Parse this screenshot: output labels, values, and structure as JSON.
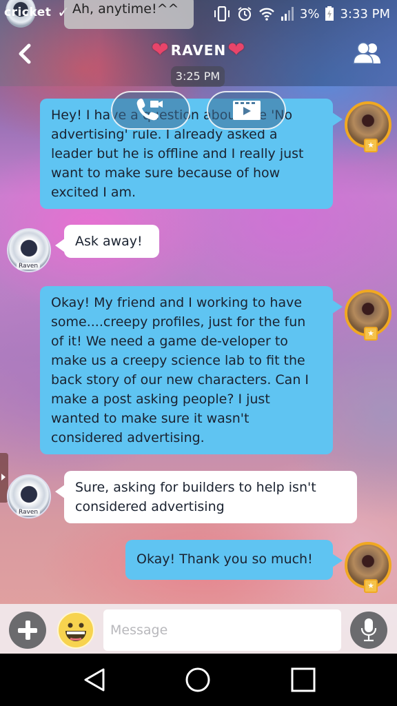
{
  "status_bar": {
    "carrier": "cricket",
    "notification_text": "Ah, anytime!^^",
    "battery": "3%",
    "time": "3:33 PM",
    "icons": [
      "vibrate-icon",
      "alarm-icon",
      "wifi-icon",
      "signal-icon",
      "battery-charging-icon"
    ]
  },
  "header": {
    "title": "RAVEN",
    "title_decoration": "❤",
    "timestamp": "3:25 PM",
    "back_icon": "chevron-left-icon",
    "members_icon": "members-icon"
  },
  "call_controls": {
    "voice_call_icon": "phone-video-icon",
    "video_icon": "film-play-icon"
  },
  "messages": [
    {
      "sender": "me",
      "text": "Hey! I have a question about the 'No advertising' rule. I already asked a leader but he is offline and I really just want to make sure because of how excited I am."
    },
    {
      "sender": "them",
      "text": "Ask away!",
      "avatar_tag": "Raven"
    },
    {
      "sender": "me",
      "text": "Okay! My friend and I working to have some....creepy profiles, just for the fun of it! We need a game de-veloper to make us a creepy science lab to fit the back story of our new characters. Can I make a post asking people? I just wanted to make sure it wasn't considered advertising."
    },
    {
      "sender": "them",
      "text": "Sure, asking for builders to help isn't considered advertising",
      "avatar_tag": "Raven"
    },
    {
      "sender": "me",
      "text": "Okay! Thank you so much!"
    }
  ],
  "input_bar": {
    "placeholder": "Message",
    "value": ""
  },
  "colors": {
    "my_bubble": "#5fc4f2",
    "their_bubble": "#ffffff",
    "avatar_ring": "#f0a822",
    "heart": "#e8456a"
  }
}
